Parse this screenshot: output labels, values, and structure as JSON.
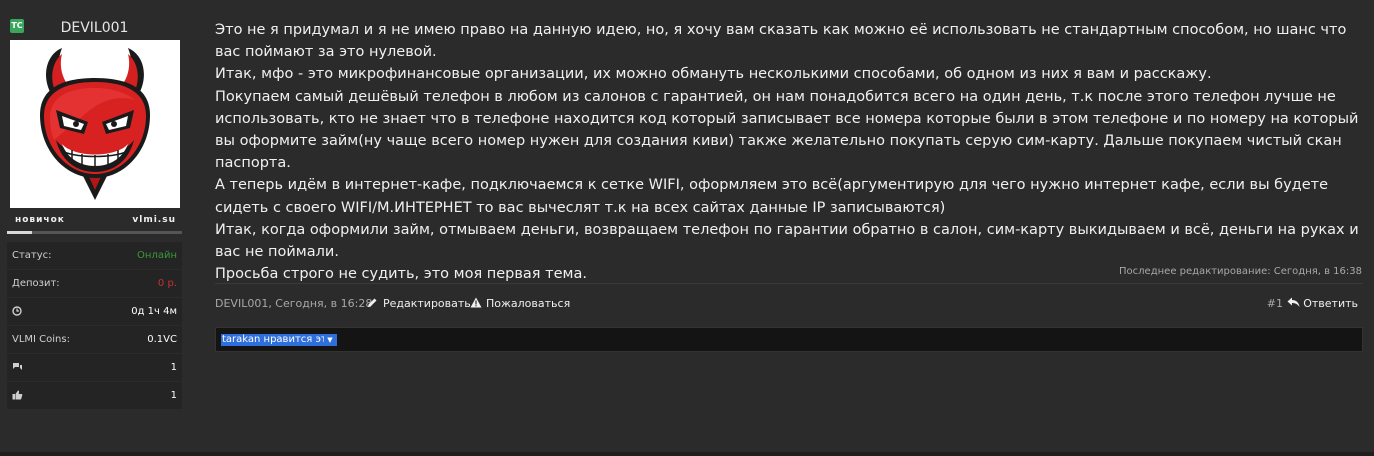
{
  "user": {
    "username": "DEVIL001",
    "badge": "TC",
    "rank": "новичок",
    "site": "vlmi.su",
    "rank_progress": 0.14,
    "avatar_icon": "red-devil-avatar",
    "stats": [
      {
        "key": "Статус:",
        "value": "Онлайн",
        "color": "#3a9a3a"
      },
      {
        "key": "Депозит:",
        "value": "0 р.",
        "color": "#c83232"
      },
      {
        "key_icon": "clock-icon",
        "value": "0д 1ч 4м"
      },
      {
        "key": "VLMI Coins:",
        "value": "0.1VC"
      },
      {
        "key_icon": "comments-icon",
        "value": "1"
      },
      {
        "key_icon": "thumbs-up-icon",
        "value": "1"
      }
    ]
  },
  "post": {
    "paragraphs": [
      "Это не я придумал и я не имею право на данную идею, но, я хочу вам сказать как можно её использовать не стандартным способом, но шанс что вас поймают за это нулевой.",
      "Итак, мфо - это микрофинансовые организации, их можно обмануть несколькими способами, об одном из них я вам и расскажу.",
      "Покупаем самый дешёвый телефон в любом из салонов с гарантией, он нам понадобится всего на один день, т.к после этого телефон лучше не использовать, кто не знает что в телефоне находится код который записывает все номера которые были в этом телефоне и по номеру на который вы оформите займ(ну чаще всего номер нужен для создания киви) также желательно покупать серую сим-карту. Дальше покупаем чистый скан паспорта.",
      "А теперь идём в интернет-кафе, подключаемся к сетке WIFI, оформляем это всё(аргументирую для чего нужно интернет кафе, если вы будете сидеть с своего WIFI/М.ИНТЕРНЕТ то вас вычеслят т.к на всех сайтах данные IP записываются)",
      "Итак, когда оформили займ, отмываем деньги, возвращаем телефон по гарантии обратно в салон, сим-карту выкидываем и всё, деньги на руках и вас не поймали.",
      "Просьба строго не судить, это моя первая тема."
    ],
    "last_edit": "Последнее редактирование: Сегодня, в 16:38",
    "author_date": "DEVIL001, Сегодня, в 16:28",
    "edit_label": "Редактировать",
    "report_label": "Пожаловаться",
    "post_number": "#1",
    "reply_label": "Ответить",
    "likes_text": "tarakan нравится это."
  }
}
